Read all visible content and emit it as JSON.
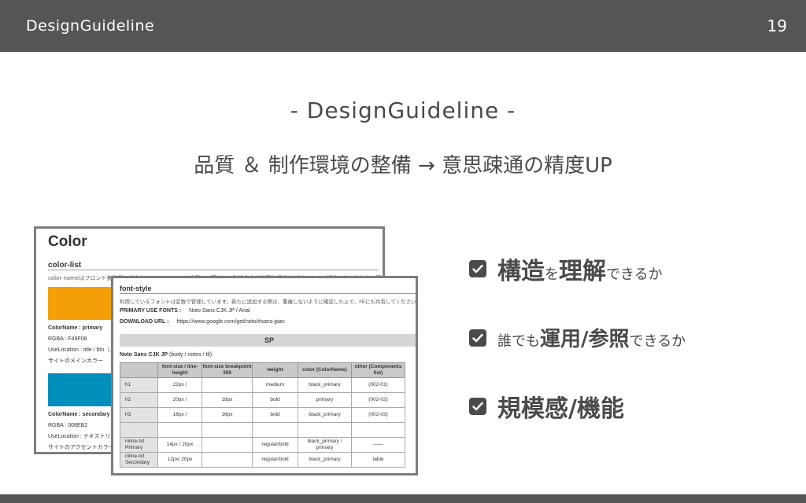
{
  "header": {
    "brand": "DesignGuideline",
    "page_number": "19"
  },
  "slide": {
    "title": "- DesignGuideline -",
    "subtitle": "品質 ＆ 制作環境の整備 → 意思疎通の精度UP"
  },
  "color_card": {
    "title": "Color",
    "subtitle": "color-list",
    "description": "color nameはフロント実装側の命名としてcoloringして使用して下さい。別途命名が必要な場合はデザイナーに相談の上で追加して下さい",
    "swatches": [
      {
        "color": "#f49f08",
        "name_line": "ColorName : primary",
        "rgba": "RGBA : F49F08",
        "use": "UseLocation : title / btn（メイン）",
        "note": "サイトのメインカラー"
      },
      {
        "color": "#008ebb",
        "name_line": "ColorName : secondary",
        "rgba": "RGBA : 008EB2",
        "use": "UseLocation : テキストリンク",
        "note": "サイトのアクセントカラー"
      }
    ]
  },
  "font_card": {
    "title": "font-style",
    "description": "利用しているフォントは変数で管理しています。新たに追加する際は、重複しないように確認した上で、FEにも共有してください",
    "primary_label": "PRIMARY USE FONTS :",
    "primary_value": "Noto Sans CJK JP / Arial",
    "download_label": "DOWNLOAD URL :",
    "download_value": "https://www.google.com/get/noto/#sans-jpan",
    "section": "SP",
    "family_name": "Noto Sans CJK JP",
    "family_note": "(body / notes / ttl)",
    "columns": [
      "",
      "font-size / line-height",
      "font-size breakpoint 359",
      "weight",
      "color (ColorName)",
      "other (Components list)"
    ],
    "rows": [
      [
        "h1",
        "22px /",
        "",
        "medium",
        "black_primary",
        "(002-01)"
      ],
      [
        "h2",
        "20px /",
        "18px",
        "bold",
        "primary",
        "(002-02)"
      ],
      [
        "h3",
        "16px /",
        "16px",
        "bold",
        "black_primary",
        "(002-03)"
      ],
      [
        "",
        "",
        "",
        "",
        "",
        ""
      ],
      [
        "inline-txt Primary",
        "14px / 20px",
        "",
        "regular/bold",
        "black_primary / primary",
        "——"
      ],
      [
        "inline-txt Secondary",
        "12px/ 20px",
        "",
        "regular/bold",
        "black_primary",
        "table"
      ]
    ]
  },
  "checklist": [
    {
      "parts": [
        {
          "t": "構造",
          "s": "big"
        },
        {
          "t": "を",
          "s": "sm"
        },
        {
          "t": "理解",
          "s": "big"
        },
        {
          "t": "できるか",
          "s": "sm"
        }
      ]
    },
    {
      "parts": [
        {
          "t": "誰でも",
          "s": "sm"
        },
        {
          "t": "運用/参照",
          "s": "med"
        },
        {
          "t": "できるか",
          "s": "sm"
        }
      ]
    },
    {
      "parts": [
        {
          "t": "規模感/機能",
          "s": "big"
        }
      ]
    }
  ]
}
